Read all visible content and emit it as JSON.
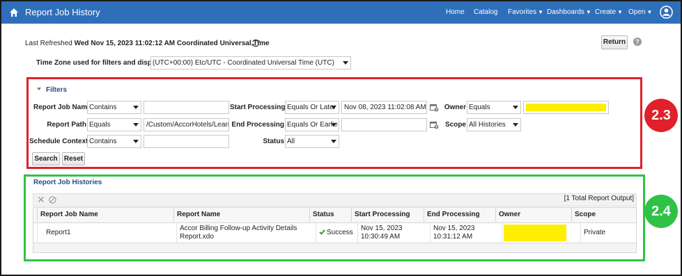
{
  "header": {
    "title": "Report Job History",
    "nav": [
      "Home",
      "Catalog",
      "Favorites",
      "Dashboards",
      "Create",
      "Open"
    ],
    "colors": {
      "bar": "#2f6fba"
    }
  },
  "refresh": {
    "prefix": "Last Refreshed",
    "timestamp": "Wed Nov 15, 2023 11:02:12 AM Coordinated Universal Time"
  },
  "return_label": "Return",
  "help_label": "?",
  "timezone": {
    "label": "Time Zone used for filters and display",
    "value": "(UTC+00:00) Etc/UTC - Coordinated Universal Time (UTC)"
  },
  "filters": {
    "heading": "Filters",
    "report_job_name": {
      "label": "Report Job Name",
      "operator": "Contains",
      "value": ""
    },
    "report_path": {
      "label": "Report Path",
      "operator": "Equals",
      "value": "/Custom/AccorHotels/Learni"
    },
    "schedule_context": {
      "label": "Schedule Context",
      "operator": "Contains",
      "value": ""
    },
    "start_processing": {
      "label": "Start Processing",
      "operator": "Equals Or Later",
      "value": "Nov 08, 2023 11:02:08 AM"
    },
    "end_processing": {
      "label": "End Processing",
      "operator": "Equals Or Earlie",
      "value": ""
    },
    "status": {
      "label": "Status",
      "value": "All"
    },
    "owner": {
      "label": "Owner",
      "operator": "Equals"
    },
    "scope": {
      "label": "Scope",
      "value": "All Histories"
    },
    "search_label": "Search",
    "reset_label": "Reset"
  },
  "annotations": {
    "filters_badge": "2.3",
    "histories_badge": "2.4",
    "red": "#e0202a",
    "green": "#2fc246",
    "redaction": "#ffee00"
  },
  "histories": {
    "heading": "Report Job Histories",
    "total": "[1 Total Report Output]",
    "columns": [
      "Report Job Name",
      "Report Name",
      "Status",
      "Start Processing",
      "End Processing",
      "Owner",
      "Scope"
    ],
    "rows": [
      {
        "job_name": "Report1",
        "report_name": "Accor Billing Follow-up Activity Details Report.xdo",
        "status": "Success",
        "start": "Nov 15, 2023 10:30:49 AM",
        "end": "Nov 15, 2023 10:31:12 AM",
        "scope": "Private"
      }
    ]
  }
}
